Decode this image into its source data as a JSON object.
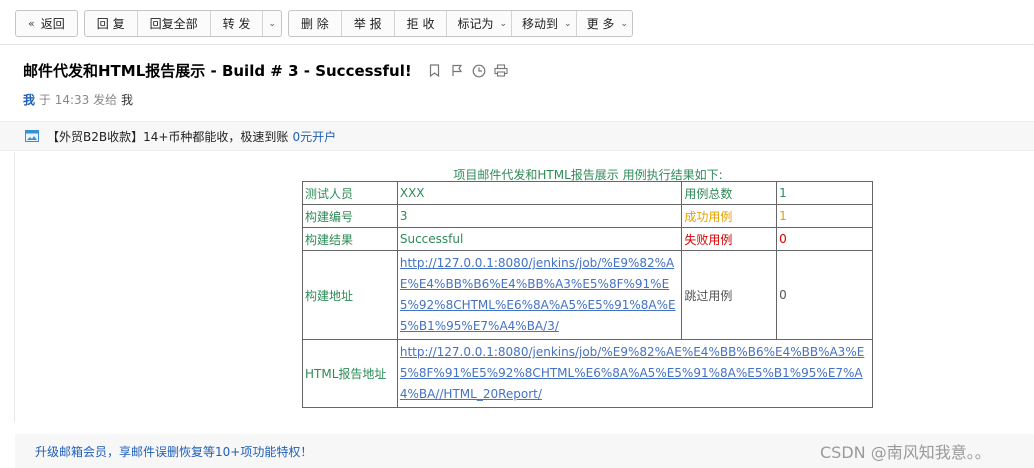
{
  "toolbar": {
    "back": "返回",
    "reply": "回 复",
    "reply_all": "回复全部",
    "forward": "转 发",
    "delete": "删 除",
    "report": "举 报",
    "reject": "拒 收",
    "mark_as": "标记为",
    "move_to": "移动到",
    "more": "更 多"
  },
  "mail": {
    "subject": "邮件代发和HTML报告展示 - Build # 3 - Successful!",
    "sender": "我",
    "at": "于",
    "time": "14:33",
    "sent_to": "发给",
    "recipient": "我"
  },
  "ad": {
    "text": "【外贸B2B收款】14+币种都能收，极速到账",
    "link": "0元开户"
  },
  "report": {
    "caption": "项目邮件代发和HTML报告展示 用例执行结果如下:",
    "tester_label": "测试人员",
    "tester_value": "XXX",
    "total_label": "用例总数",
    "total_value": "1",
    "build_no_label": "构建编号",
    "build_no_value": "3",
    "success_label": "成功用例",
    "success_value": "1",
    "build_result_label": "构建结果",
    "build_result_value": "Successful",
    "fail_label": "失败用例",
    "fail_value": "0",
    "build_url_label": "构建地址",
    "build_url_value": "http://127.0.0.1:8080/jenkins/job/%E9%82%AE%E4%BB%B6%E4%BB%A3%E5%8F%91%E5%92%8CHTML%E6%8A%A5%E5%91%8A%E5%B1%95%E7%A4%BA/3/",
    "skip_label": "跳过用例",
    "skip_value": "0",
    "html_report_label": "HTML报告地址",
    "html_report_value": "http://127.0.0.1:8080/jenkins/job/%E9%82%AE%E4%BB%B6%E4%BB%A3%E5%8F%91%E5%92%8CHTML%E6%8A%A5%E5%91%8A%E5%B1%95%E7%A4%BA//HTML_20Report/"
  },
  "footer": {
    "text": "升级邮箱会员，享邮件误删恢复等10+项功能特权！"
  },
  "watermark": "CSDN @南风知我意。。",
  "colors": {
    "green": "#2e8b57",
    "orange": "#e6a100",
    "red": "#d40000",
    "link": "#4472c4",
    "brand_blue": "#1f5fb8"
  }
}
